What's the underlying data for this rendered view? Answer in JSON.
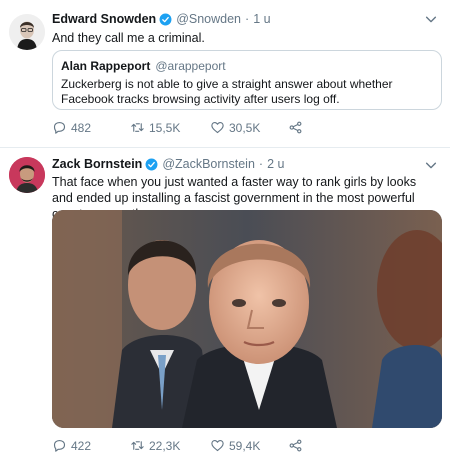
{
  "tweets": [
    {
      "author": "Edward Snowden",
      "handle": "@Snowden",
      "time": "1 u",
      "text": "And they call me a criminal.",
      "quote": {
        "author": "Alan Rappeport",
        "handle": "@arappeport",
        "text": "Zuckerberg is not able to give a straight answer about whether Facebook tracks browsing activity after users log off."
      },
      "replies": "482",
      "retweets": "15,5K",
      "likes": "30,5K"
    },
    {
      "author": "Zack Bornstein",
      "handle": "@ZackBornstein",
      "time": "2 u",
      "text": "That face when you just wanted a faster way to rank girls by looks and ended up installing a fascist government in the most powerful country on earth",
      "replies": "422",
      "retweets": "22,3K",
      "likes": "59,4K"
    }
  ],
  "icons": {
    "verified": "verified-badge-icon",
    "menu": "chevron-down-icon",
    "reply": "reply-icon",
    "retweet": "retweet-icon",
    "like": "heart-icon",
    "share": "share-icon"
  },
  "colors": {
    "verified": "#1da1f2",
    "secondary_text": "#657786",
    "border": "#e6ecf0"
  }
}
